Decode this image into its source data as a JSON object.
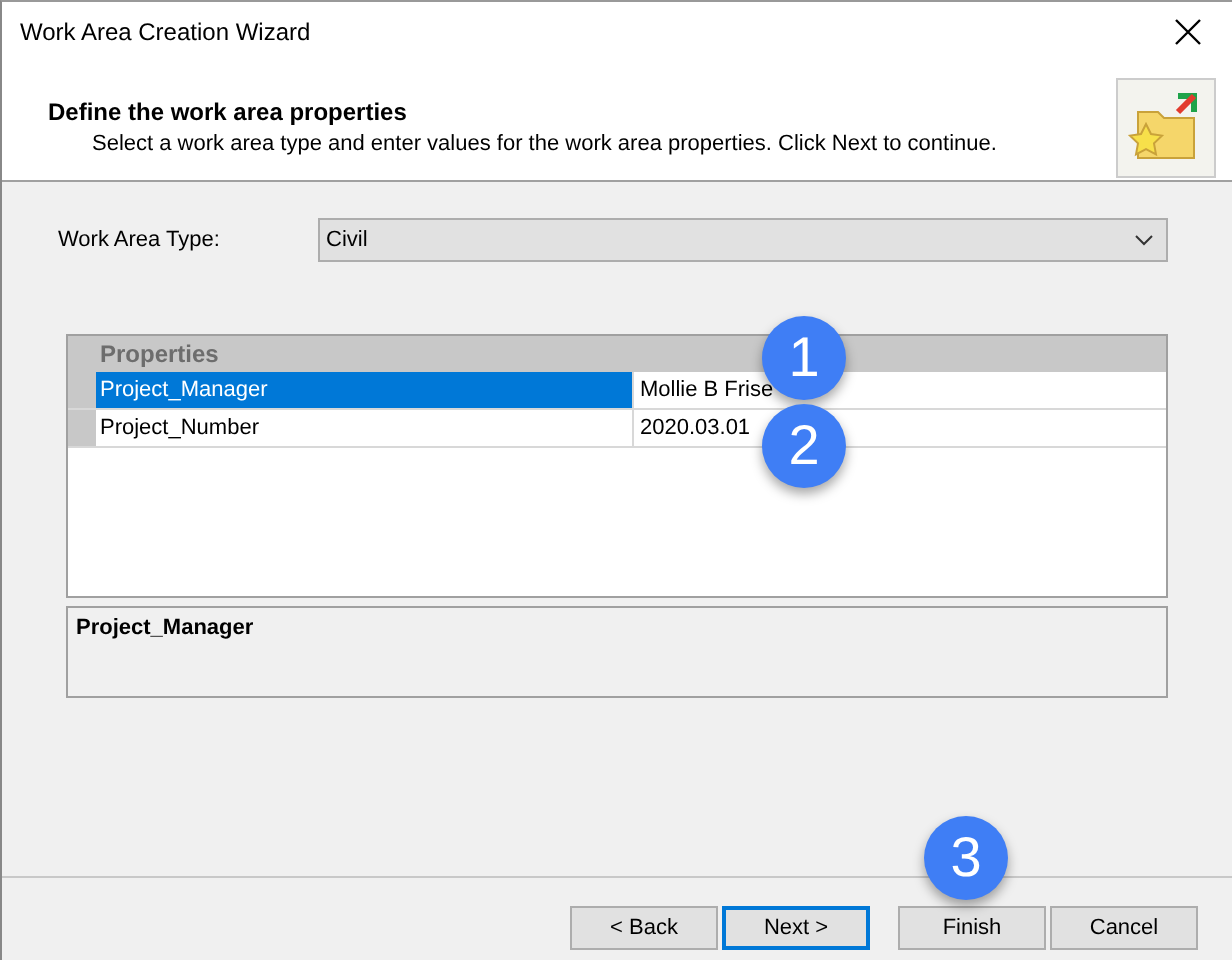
{
  "window": {
    "title": "Work Area Creation Wizard"
  },
  "header": {
    "title": "Define the work area properties",
    "subtitle": "Select a work area type and enter values for the work area properties. Click Next to continue."
  },
  "work_area_type": {
    "label": "Work Area Type:",
    "value": "Civil"
  },
  "properties": {
    "heading": "Properties",
    "rows": [
      {
        "name": "Project_Manager",
        "value": "Mollie B Frise",
        "selected": true
      },
      {
        "name": "Project_Number",
        "value": "2020.03.01",
        "selected": false
      }
    ]
  },
  "description": {
    "title": "Project_Manager"
  },
  "buttons": [
    {
      "label": "< Back",
      "default": false
    },
    {
      "label": "Next >",
      "default": true
    },
    {
      "label": "Finish",
      "default": false
    },
    {
      "label": "Cancel",
      "default": false
    }
  ],
  "callouts": [
    {
      "label": "1"
    },
    {
      "label": "2"
    },
    {
      "label": "3"
    }
  ]
}
